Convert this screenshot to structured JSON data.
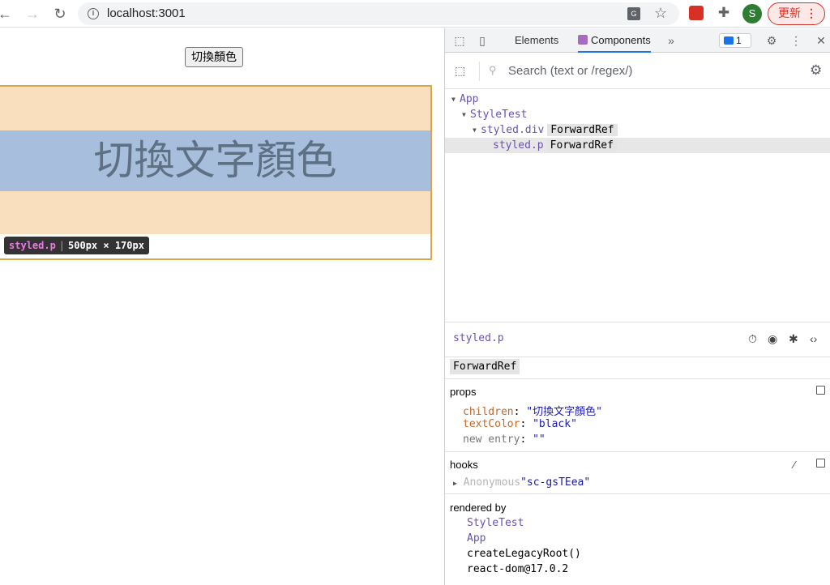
{
  "browser": {
    "url": "localhost:3001",
    "update_label": "更新",
    "avatar_letter": "S"
  },
  "page": {
    "toggle_button": "切換顏色",
    "content_text": "切換文字顏色",
    "inspect_tag": "styled.p",
    "inspect_size": "500px × 170px"
  },
  "devtools": {
    "tabs": {
      "elements": "Elements",
      "components": "Components"
    },
    "issues_count": "1",
    "search_placeholder": "Search (text or /regex/)",
    "tree": [
      {
        "name": "App",
        "badge": ""
      },
      {
        "name": "StyleTest",
        "badge": ""
      },
      {
        "name": "styled.div",
        "badge": "ForwardRef"
      },
      {
        "name": "styled.p",
        "badge": "ForwardRef"
      }
    ],
    "selected": {
      "name": "styled.p",
      "badge": "ForwardRef"
    },
    "props": {
      "title": "props",
      "children_key": "children",
      "children_val": "\"切換文字顏色\"",
      "textcolor_key": "textColor",
      "textcolor_val": "\"black\"",
      "new_key": "new entry",
      "new_val": "\"\""
    },
    "hooks": {
      "title": "hooks",
      "anon": "Anonymous",
      "val": "\"sc-gsTEea\""
    },
    "rendered_by": {
      "title": "rendered by",
      "items": [
        "StyleTest",
        "App",
        "createLegacyRoot()",
        "react-dom@17.0.2"
      ]
    }
  }
}
